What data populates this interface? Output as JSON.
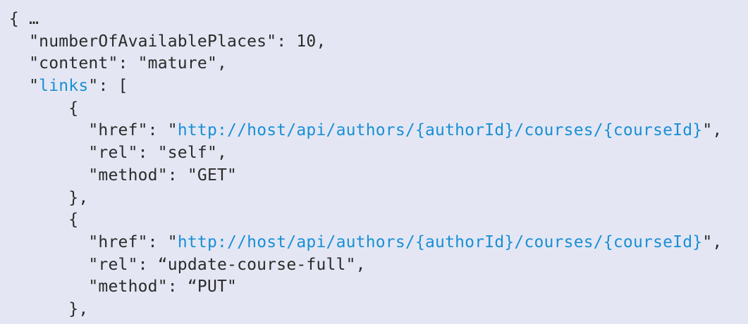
{
  "colors": {
    "background": "#e4e7f3",
    "text": "#2b2b2b",
    "highlight": "#1a8fd6"
  },
  "code": {
    "lines": [
      [
        {
          "t": "{ …",
          "hl": false
        }
      ],
      [
        {
          "t": "  \"numberOfAvailablePlaces\": 10,",
          "hl": false
        }
      ],
      [
        {
          "t": "  \"content\": \"mature\",",
          "hl": false
        }
      ],
      [
        {
          "t": "  \"",
          "hl": false
        },
        {
          "t": "links",
          "hl": true
        },
        {
          "t": "\": [",
          "hl": false
        }
      ],
      [
        {
          "t": "      {",
          "hl": false
        }
      ],
      [
        {
          "t": "        \"href\": \"",
          "hl": false
        },
        {
          "t": "http://host/api/authors/{authorId}/courses/{courseId}",
          "hl": true
        },
        {
          "t": "\",",
          "hl": false
        }
      ],
      [
        {
          "t": "        \"rel\": \"self\",",
          "hl": false
        }
      ],
      [
        {
          "t": "        \"method\": \"GET\"",
          "hl": false
        }
      ],
      [
        {
          "t": "      },",
          "hl": false
        }
      ],
      [
        {
          "t": "      {",
          "hl": false
        }
      ],
      [
        {
          "t": "        \"href\": \"",
          "hl": false
        },
        {
          "t": "http://host/api/authors/{authorId}/courses/{courseId}",
          "hl": true
        },
        {
          "t": "\",",
          "hl": false
        }
      ],
      [
        {
          "t": "        \"rel\": “update-course-full\",",
          "hl": false
        }
      ],
      [
        {
          "t": "        \"method\": “PUT\"",
          "hl": false
        }
      ],
      [
        {
          "t": "      },",
          "hl": false
        }
      ]
    ]
  }
}
